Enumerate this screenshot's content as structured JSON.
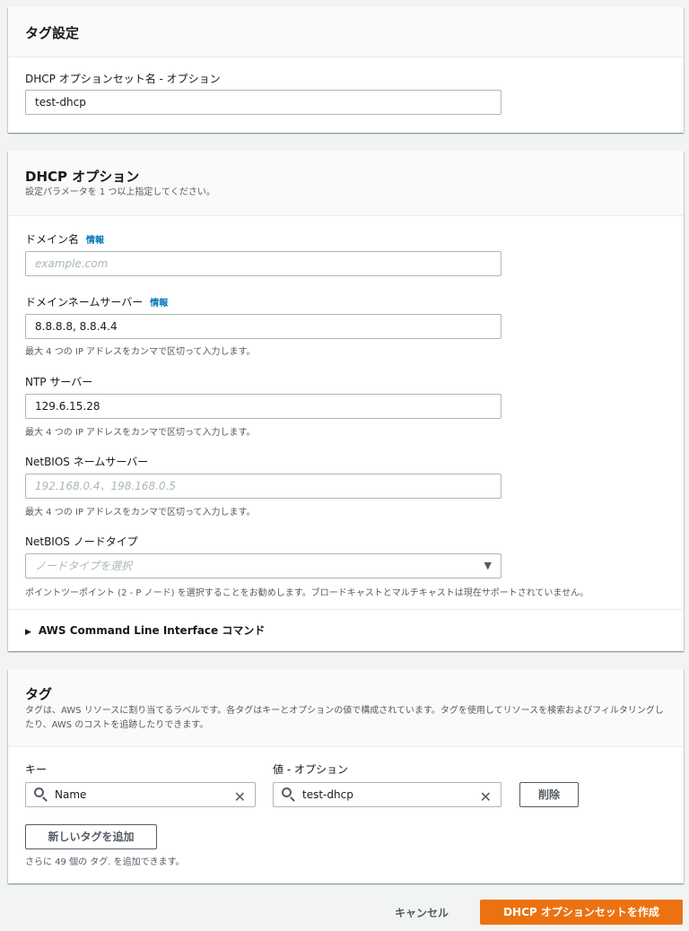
{
  "tag_settings": {
    "title": "タグ設定",
    "name_label": "DHCP オプションセット名 - オプション",
    "name_value": "test-dhcp"
  },
  "dhcp_options": {
    "title": "DHCP オプション",
    "subtitle": "設定パラメータを 1 つ以上指定してください。",
    "domain_name": {
      "label": "ドメイン名",
      "info": "情報",
      "placeholder": "example.com"
    },
    "dns": {
      "label": "ドメインネームサーバー",
      "info": "情報",
      "value": "8.8.8.8, 8.8.4.4",
      "hint": "最大 4 つの IP アドレスをカンマで区切って入力します。"
    },
    "ntp": {
      "label": "NTP サーバー",
      "value": "129.6.15.28",
      "hint": "最大 4 つの IP アドレスをカンマで区切って入力します。"
    },
    "netbios_ns": {
      "label": "NetBIOS ネームサーバー",
      "placeholder": "192.168.0.4、198.168.0.5",
      "hint": "最大 4 つの IP アドレスをカンマで区切って入力します。"
    },
    "netbios_node": {
      "label": "NetBIOS ノードタイプ",
      "placeholder": "ノードタイプを選択",
      "hint": "ポイントツーポイント (2 - P ノード) を選択することをお勧めします。ブロードキャストとマルチキャストは現在サポートされていません。"
    },
    "cli": "AWS Command Line Interface コマンド"
  },
  "tags": {
    "title": "タグ",
    "description": "タグは、AWS リソースに割り当てるラベルです。各タグはキーとオプションの値で構成されています。タグを使用してリソースを検索およびフィルタリングしたり、AWS のコストを追跡したりできます。",
    "key_label": "キー",
    "value_label": "値 - オプション",
    "key_value": "Name",
    "value_value": "test-dhcp",
    "remove": "削除",
    "add": "新しいタグを追加",
    "remaining": "さらに 49 個の タグ. を追加できます。"
  },
  "footer": {
    "cancel": "キャンセル",
    "create": "DHCP オプションセットを作成"
  },
  "colors": {
    "primary": "#ec7211",
    "link": "#0073bb"
  }
}
